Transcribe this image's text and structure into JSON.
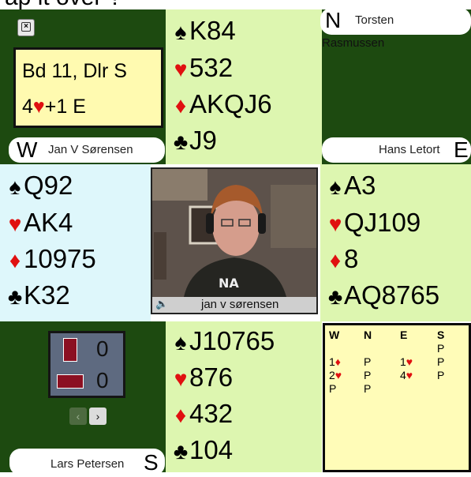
{
  "board": {
    "line1": "Bd 11, Dlr S",
    "contract_level": "4",
    "contract_suffix": "+1 E"
  },
  "players": {
    "north": {
      "dir": "N",
      "first": "Torsten",
      "last": "Rasmussen"
    },
    "west": {
      "dir": "W",
      "name": "Jan V Sørensen"
    },
    "east": {
      "dir": "E",
      "name": "Hans Letort"
    },
    "south": {
      "dir": "S",
      "name": "Lars Petersen"
    }
  },
  "hands": {
    "north": {
      "spades": "K84",
      "hearts": "532",
      "diamonds": "AKQJ6",
      "clubs": "J9"
    },
    "west": {
      "spades": "Q92",
      "hearts": "AK4",
      "diamonds": "10975",
      "clubs": "K32"
    },
    "east": {
      "spades": "A3",
      "hearts": "QJ109",
      "diamonds": "8",
      "clubs": "AQ8765"
    },
    "south": {
      "spades": "J10765",
      "hearts": "876",
      "diamonds": "432",
      "clubs": "104"
    }
  },
  "video": {
    "label": "jan v sørensen"
  },
  "tricks": {
    "ns": "0",
    "ew": "0"
  },
  "auction": {
    "headers": [
      "W",
      "N",
      "E",
      "S"
    ],
    "rows": [
      [
        "",
        "",
        "",
        "P"
      ],
      [
        "1♦",
        "P",
        "1♥",
        "P"
      ],
      [
        "2♥",
        "P",
        "4♥",
        "P"
      ],
      [
        "P",
        "P",
        "",
        ""
      ]
    ]
  },
  "colors": {
    "felt": "#1d4a10",
    "ns_hand": "#ddf6b0",
    "ew_hand": "#def7fb",
    "red_suit": "#e01010"
  }
}
